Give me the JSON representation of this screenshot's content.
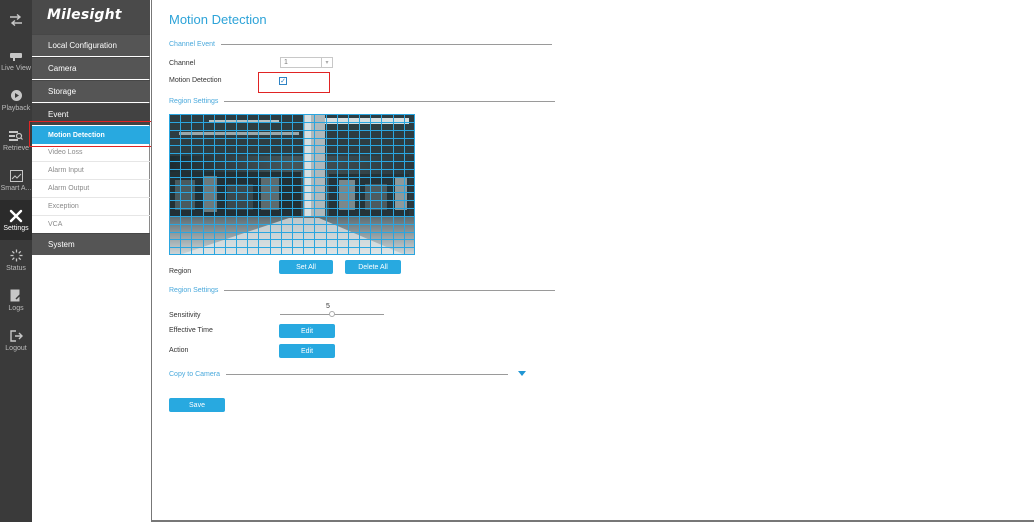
{
  "brand": {
    "name": "Milesight"
  },
  "rail": {
    "items": [
      {
        "label": "",
        "icon": "switch-arrows-icon"
      },
      {
        "label": "Live View",
        "icon": "live-view-icon"
      },
      {
        "label": "Playback",
        "icon": "playback-icon"
      },
      {
        "label": "Retrieve",
        "icon": "retrieve-icon"
      },
      {
        "label": "Smart A...",
        "icon": "smart-analytics-icon"
      },
      {
        "label": "Settings",
        "icon": "settings-icon"
      },
      {
        "label": "Status",
        "icon": "status-icon"
      },
      {
        "label": "Logs",
        "icon": "logs-icon"
      },
      {
        "label": "Logout",
        "icon": "logout-icon"
      }
    ]
  },
  "menu": {
    "local_configuration": "Local Configuration",
    "camera": "Camera",
    "storage": "Storage",
    "event": "Event",
    "event_items": [
      "Motion Detection",
      "Video Loss",
      "Alarm Input",
      "Alarm Output",
      "Exception",
      "VCA"
    ],
    "system": "System"
  },
  "page": {
    "title": "Motion Detection",
    "channel_event_section": "Channel Event",
    "channel_label": "Channel",
    "channel_value": "1",
    "motion_detection_label": "Motion Detection",
    "motion_detection_checked": true,
    "region_settings_section": "Region Settings",
    "region_label": "Region",
    "set_all": "Set All",
    "delete_all": "Delete All",
    "region_settings_section_2": "Region Settings",
    "sensitivity_label": "Sensitivity",
    "sensitivity_value": "5",
    "effective_time_label": "Effective Time",
    "effective_time_button": "Edit",
    "action_label": "Action",
    "action_button": "Edit",
    "copy_to_camera": "Copy to Camera",
    "save": "Save"
  },
  "colors": {
    "accent": "#28a9e0",
    "rail_bg": "#3a3a3a",
    "menu_dark": "#555555",
    "grid_line": "#2aa6e0",
    "callout": "#e02424"
  }
}
